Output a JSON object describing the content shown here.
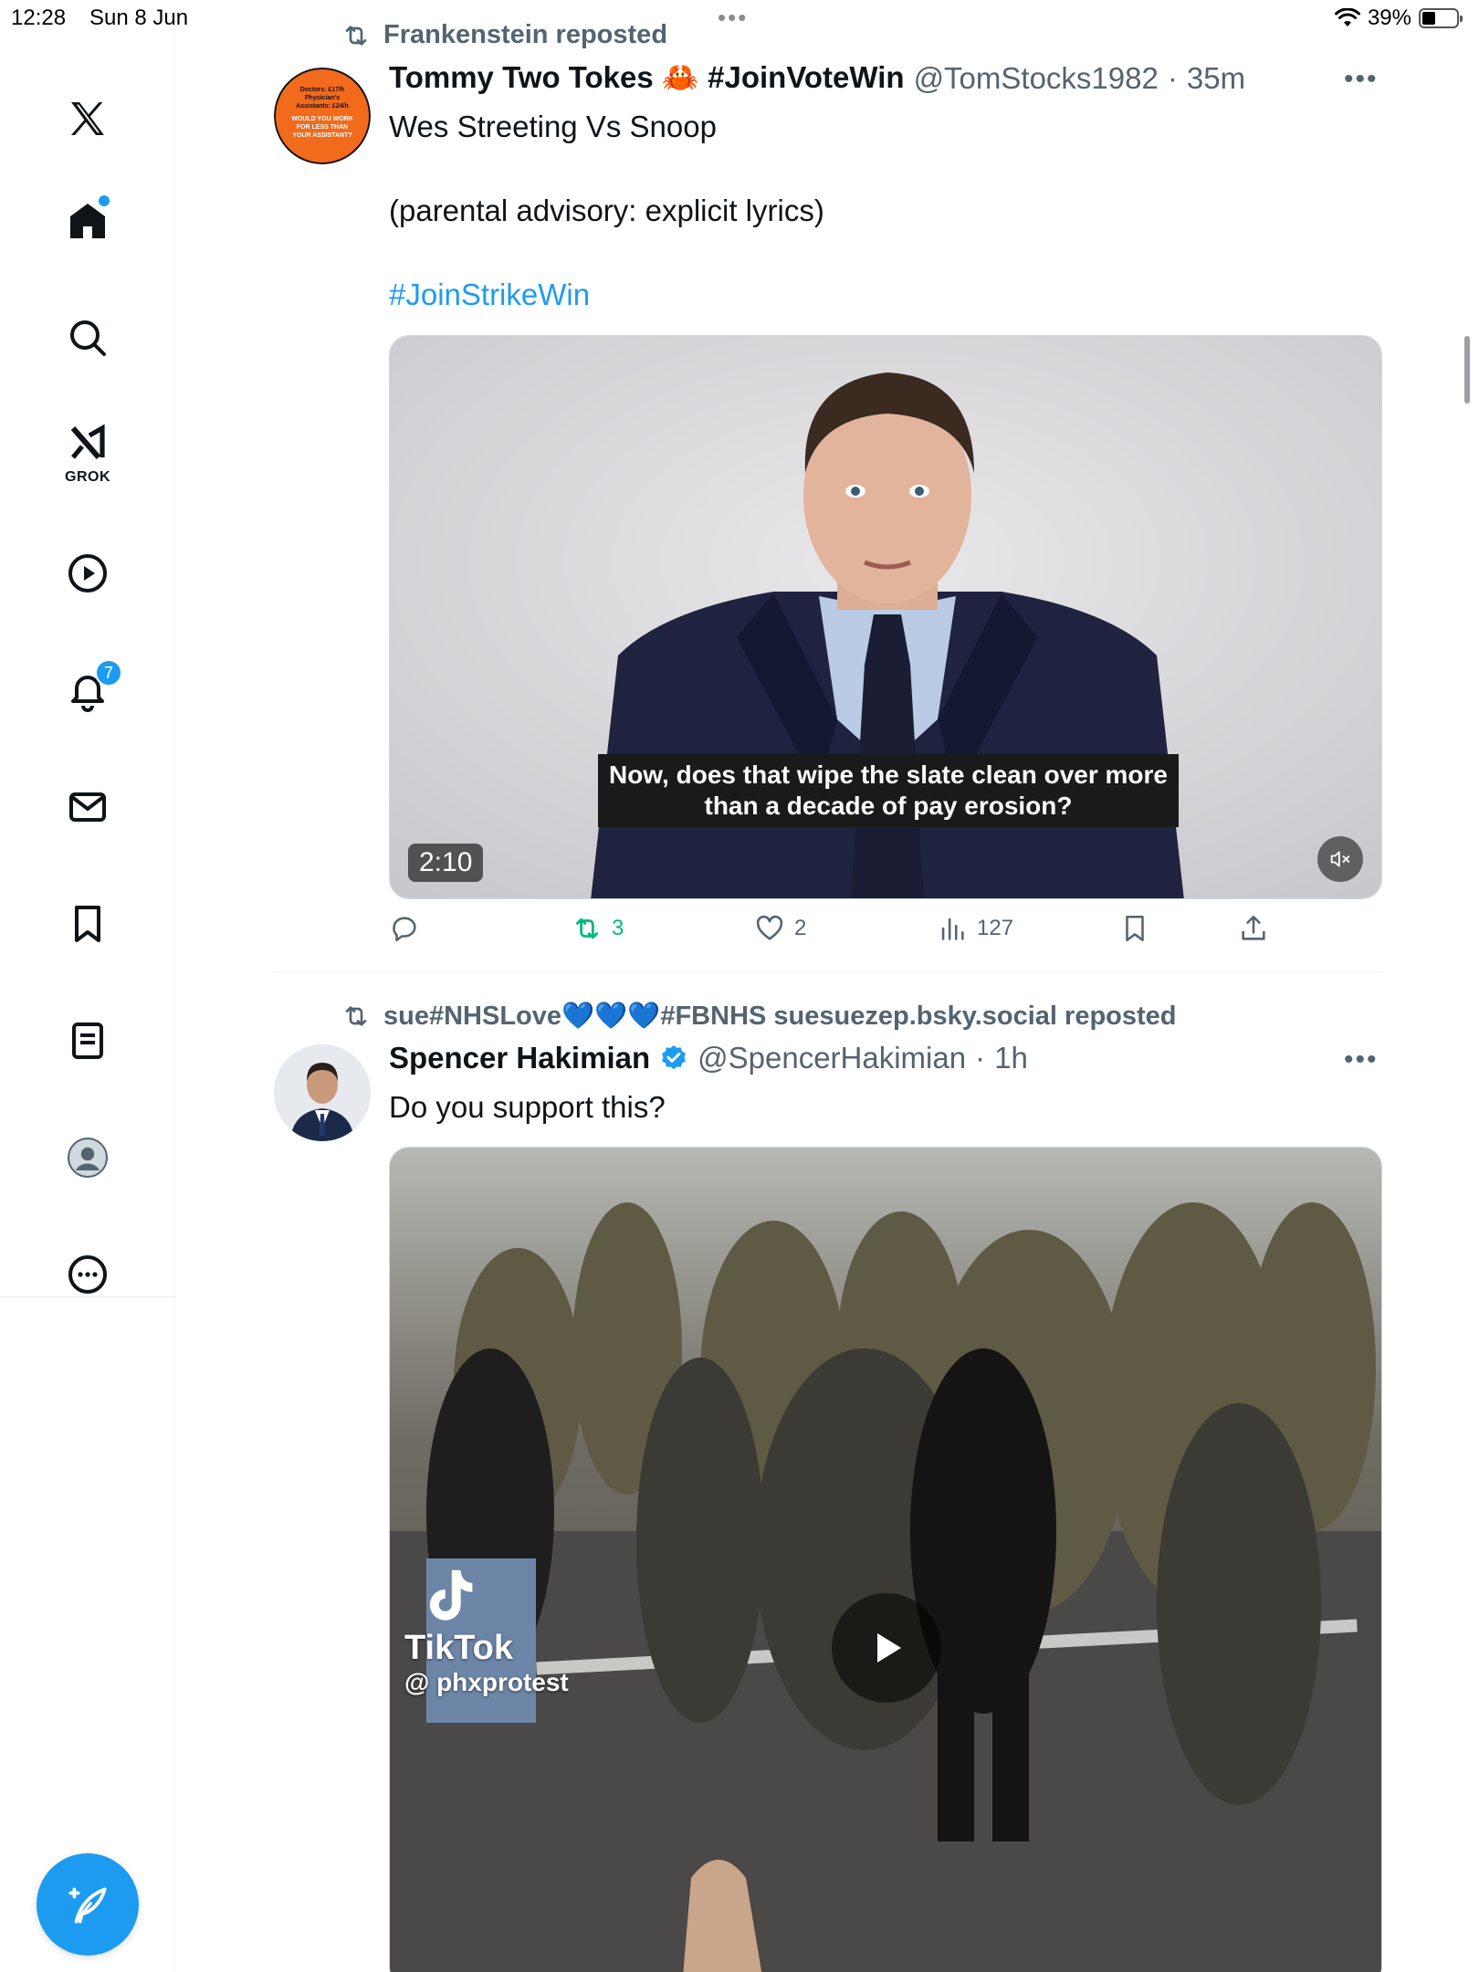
{
  "status_bar": {
    "time": "12:28",
    "date": "Sun 8 Jun",
    "battery": "39%",
    "battery_level": 0.39
  },
  "sidebar": {
    "items": [
      {
        "icon": "x-logo-icon"
      },
      {
        "icon": "home-icon",
        "has_dot": true
      },
      {
        "icon": "search-icon"
      },
      {
        "icon": "grok-icon",
        "label": "GROK"
      },
      {
        "icon": "video-play-icon"
      },
      {
        "icon": "bell-icon",
        "badge": "7"
      },
      {
        "icon": "mail-icon"
      },
      {
        "icon": "bookmark-icon"
      },
      {
        "icon": "lists-icon"
      },
      {
        "icon": "profile-icon"
      },
      {
        "icon": "more-icon"
      }
    ],
    "compose_icon": "compose-post-icon"
  },
  "colors": {
    "accent": "#1d9bf0",
    "secondary_text": "#536471",
    "repost_green": "#00ba7c"
  },
  "posts": [
    {
      "repost_by": "Frankenstein reposted",
      "author_name": "Tommy Two Tokes 🦀 #JoinVoteWin",
      "handle": "@TomStocks1982",
      "separator": "·",
      "time": "35m",
      "text_line1": "Wes Streeting Vs Snoop",
      "text_line2": "(parental advisory: explicit lyrics)",
      "hashtag": "#JoinStrikeWin",
      "avatar_text": "Doctors: £17/h Physician's Assistants: £24/h WOULD YOU WORK FOR LESS THAN YOUR ASSISTANT?",
      "video": {
        "duration": "2:10",
        "caption": "Now, does that wipe the slate clean over more than a decade of pay erosion?"
      },
      "stats": {
        "reposts": "3",
        "likes": "2",
        "views": "127"
      }
    },
    {
      "repost_by": "sue#NHSLove💙💙💙#FBNHS suesuezep.bsky.social reposted",
      "author_name": "Spencer Hakimian",
      "verified": true,
      "handle": "@SpencerHakimian",
      "separator": "·",
      "time": "1h",
      "text_line1": "Do you support this?",
      "video": {
        "watermark_brand": "TikTok",
        "watermark_user": "@ phxprotest"
      }
    }
  ]
}
